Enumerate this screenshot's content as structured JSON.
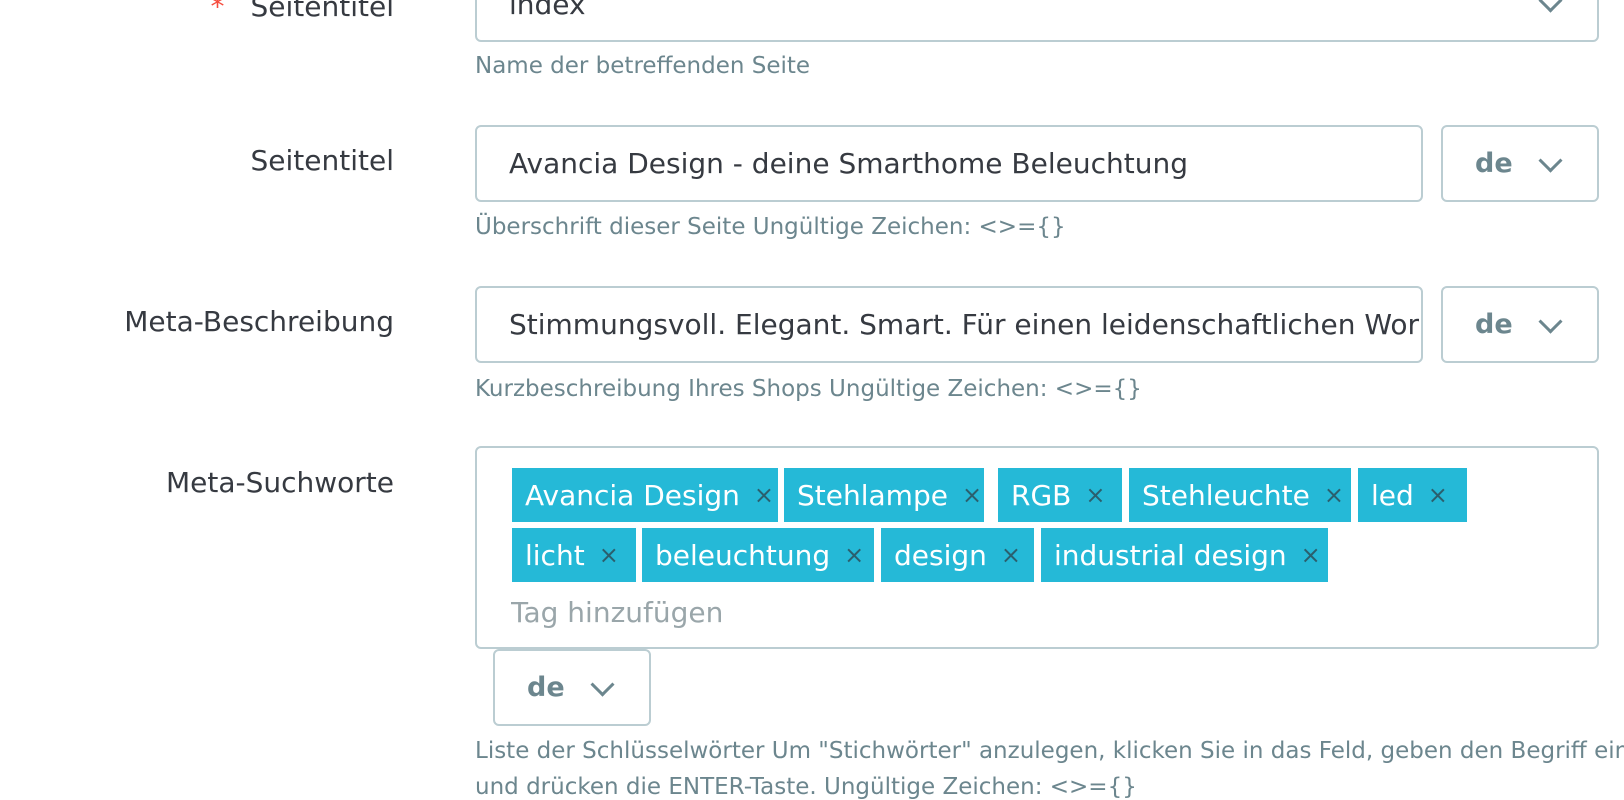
{
  "fields": {
    "page_name": {
      "label": "Seitentitel",
      "required_marker": "*",
      "value": "index",
      "help": "Name der betreffenden Seite"
    },
    "page_title": {
      "label": "Seitentitel",
      "value": "Avancia Design - deine Smarthome Beleuchtung",
      "lang": "de",
      "help": "Überschrift dieser Seite Ungültige Zeichen: <>={}"
    },
    "meta_description": {
      "label": "Meta-Beschreibung",
      "value": "Stimmungsvoll. Elegant. Smart. Für einen leidenschaftlichen Workflow",
      "lang": "de",
      "help": "Kurzbeschreibung Ihres Shops Ungültige Zeichen: <>={}"
    },
    "meta_keywords": {
      "label": "Meta-Suchworte",
      "tags": [
        "Avancia Design",
        "Stehlampe",
        "RGB",
        "Stehleuchte",
        "led",
        "licht",
        "beleuchtung",
        "design",
        "industrial design"
      ],
      "tag_remove_symbol": "×",
      "placeholder": "Tag hinzufügen",
      "lang": "de",
      "help_line1": "Liste der Schlüsselwörter Um \"Stichwörter\" anzulegen, klicken Sie in das Feld, geben den Begriff ein",
      "help_line2": "und drücken die ENTER-Taste. Ungültige Zeichen: <>={}"
    }
  },
  "colors": {
    "accent": "#25b9d7",
    "required": "#f54c3e",
    "help_text": "#6c868e",
    "border": "#bbcdd2"
  }
}
